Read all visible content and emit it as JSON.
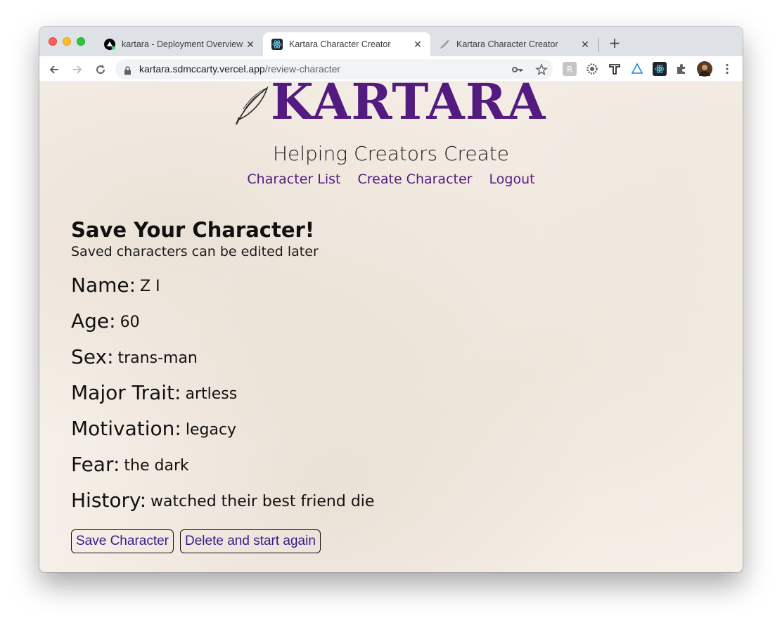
{
  "browser": {
    "tabs": [
      {
        "title": "kartara - Deployment Overview",
        "icon": "vercel-icon"
      },
      {
        "title": "Kartara Character Creator",
        "icon": "react-icon"
      },
      {
        "title": "Kartara Character Creator",
        "icon": "quill-icon"
      }
    ],
    "new_tab": "+",
    "url_host": "kartara.sdmccarty.vercel.app",
    "url_path": "/review-character"
  },
  "site": {
    "logo_text": "KARTARA",
    "tagline": "Helping Creators Create",
    "nav": {
      "character_list": "Character List",
      "create_character": "Create Character",
      "logout": "Logout"
    }
  },
  "review": {
    "heading": "Save Your Character!",
    "subheading": "Saved characters can be edited later",
    "fields": [
      {
        "label": "Name:",
        "value": "Z I"
      },
      {
        "label": "Age:",
        "value": "60"
      },
      {
        "label": "Sex:",
        "value": "trans-man"
      },
      {
        "label": "Major Trait:",
        "value": "artless"
      },
      {
        "label": "Motivation:",
        "value": "legacy"
      },
      {
        "label": "Fear:",
        "value": "the dark"
      },
      {
        "label": "History:",
        "value": "watched their best friend die"
      }
    ],
    "save_button": "Save Character",
    "delete_button": "Delete and start again"
  },
  "colors": {
    "brand_purple": "#531a80",
    "page_background": "#f6efe7"
  }
}
